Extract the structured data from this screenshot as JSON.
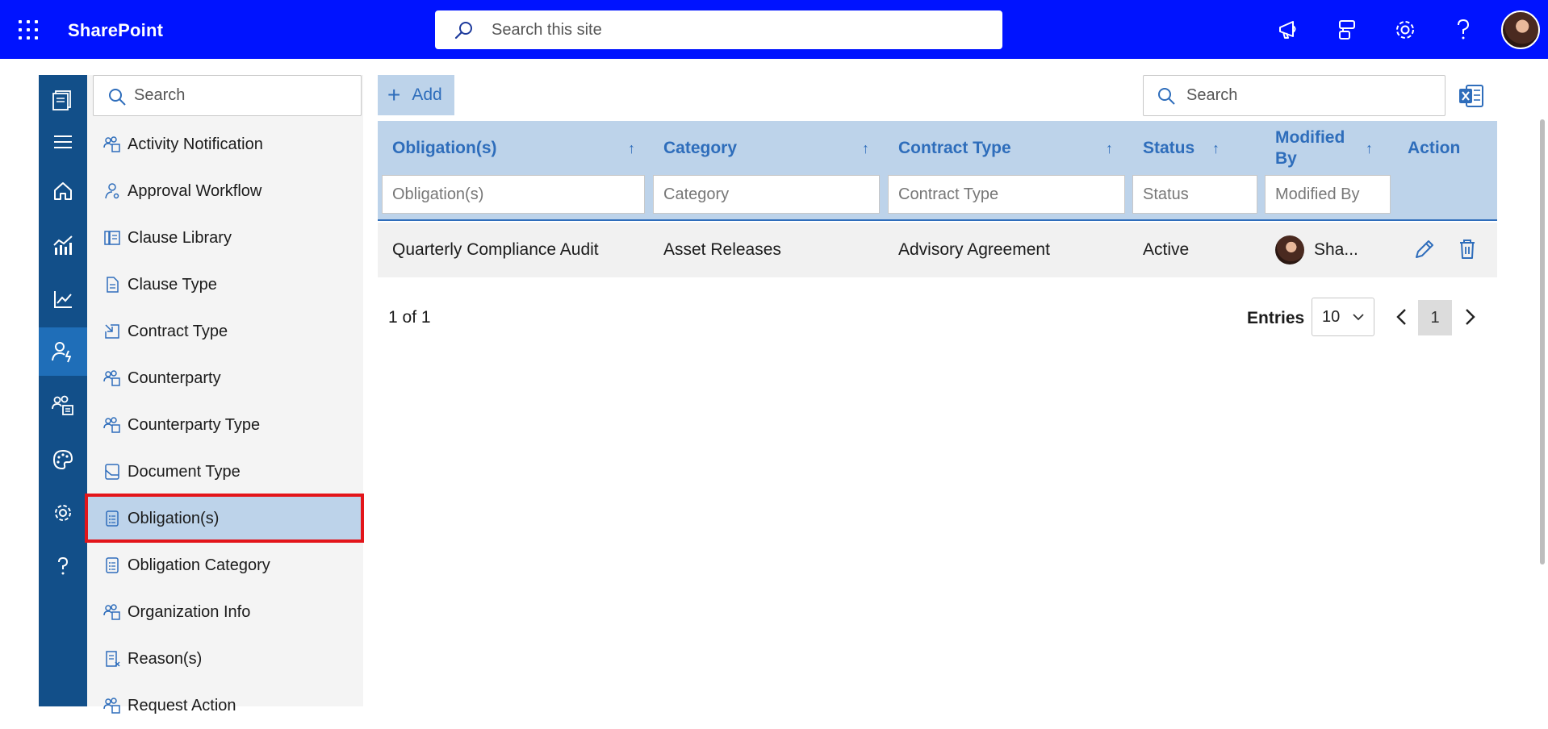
{
  "header": {
    "brand": "SharePoint",
    "search_placeholder": "Search this site",
    "icons": [
      "app-launcher-icon",
      "megaphone-icon",
      "feedback-icon",
      "settings-icon",
      "help-icon"
    ]
  },
  "rail": {
    "items": [
      "library-icon",
      "menu-icon",
      "home-icon",
      "dashboard-icon",
      "analytics-icon",
      "user-settings-icon",
      "groups-icon",
      "palette-icon",
      "settings-icon",
      "help-icon"
    ],
    "active_index": 5
  },
  "sidebar": {
    "search_placeholder": "Search",
    "items": [
      {
        "label": "Activity Notification",
        "icon": "people-icon"
      },
      {
        "label": "Approval Workflow",
        "icon": "people-flow-icon"
      },
      {
        "label": "Clause Library",
        "icon": "library-icon"
      },
      {
        "label": "Clause Type",
        "icon": "document-icon"
      },
      {
        "label": "Contract Type",
        "icon": "arrow-in-icon"
      },
      {
        "label": "Counterparty",
        "icon": "people-icon"
      },
      {
        "label": "Counterparty Type",
        "icon": "people-icon"
      },
      {
        "label": "Document Type",
        "icon": "document-corner-icon"
      },
      {
        "label": "Obligation(s)",
        "icon": "list-doc-icon"
      },
      {
        "label": "Obligation Category",
        "icon": "list-doc-icon"
      },
      {
        "label": "Organization Info",
        "icon": "people-icon"
      },
      {
        "label": "Reason(s)",
        "icon": "doc-x-icon"
      },
      {
        "label": "Request Action",
        "icon": "people-icon"
      }
    ],
    "selected_index": 8
  },
  "toolbar": {
    "add_label": "Add",
    "search_placeholder": "Search"
  },
  "table": {
    "columns": [
      {
        "label": "Obligation(s)",
        "filter_placeholder": "Obligation(s)"
      },
      {
        "label": "Category",
        "filter_placeholder": "Category"
      },
      {
        "label": "Contract Type",
        "filter_placeholder": "Contract Type"
      },
      {
        "label": "Status",
        "filter_placeholder": "Status"
      },
      {
        "label": "Modified By",
        "filter_placeholder": "Modified By"
      },
      {
        "label": "Action"
      }
    ],
    "rows": [
      {
        "obligation": "Quarterly Compliance Audit",
        "category": "Asset Releases",
        "contract_type": "Advisory Agreement",
        "status": "Active",
        "modified_by": "Sha..."
      }
    ]
  },
  "pager": {
    "info": "1 of 1",
    "entries_label": "Entries",
    "entries_value": "10",
    "current_page": "1"
  },
  "colors": {
    "topbar": "#0013ff",
    "rail": "#124f89",
    "rail_active": "#1f6eb8",
    "header_bg": "#bdd3ea",
    "accent": "#2e6dbb",
    "highlight": "#e3151a"
  }
}
